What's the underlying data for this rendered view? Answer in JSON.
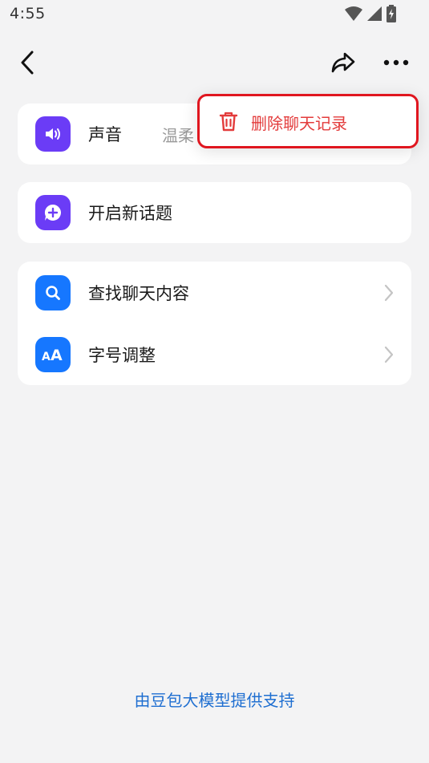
{
  "status_bar": {
    "time": "4:55",
    "icons": [
      "wifi-icon",
      "signal-icon",
      "battery-charging-icon"
    ]
  },
  "nav": {
    "back_icon": "chevron-left-icon",
    "share_icon": "share-icon",
    "more_icon": "more-dots-icon"
  },
  "settings": {
    "sound": {
      "label": "声音",
      "value": "温柔",
      "icon": "speaker-icon"
    },
    "new_topic": {
      "label": "开启新话题",
      "icon": "chat-plus-icon"
    },
    "search_chat": {
      "label": "查找聊天内容",
      "icon": "search-icon"
    },
    "font_size": {
      "label": "字号调整",
      "icon": "font-size-icon"
    }
  },
  "popup_menu": {
    "delete_label": "删除聊天记录",
    "delete_icon": "trash-icon"
  },
  "footer": {
    "text": "由豆包大模型提供支持"
  },
  "colors": {
    "background": "#f3f3f4",
    "purple_icon": "#6b3cf6",
    "blue_icon": "#1677ff",
    "danger": "#e33b3b",
    "link": "#1f6fd1"
  }
}
